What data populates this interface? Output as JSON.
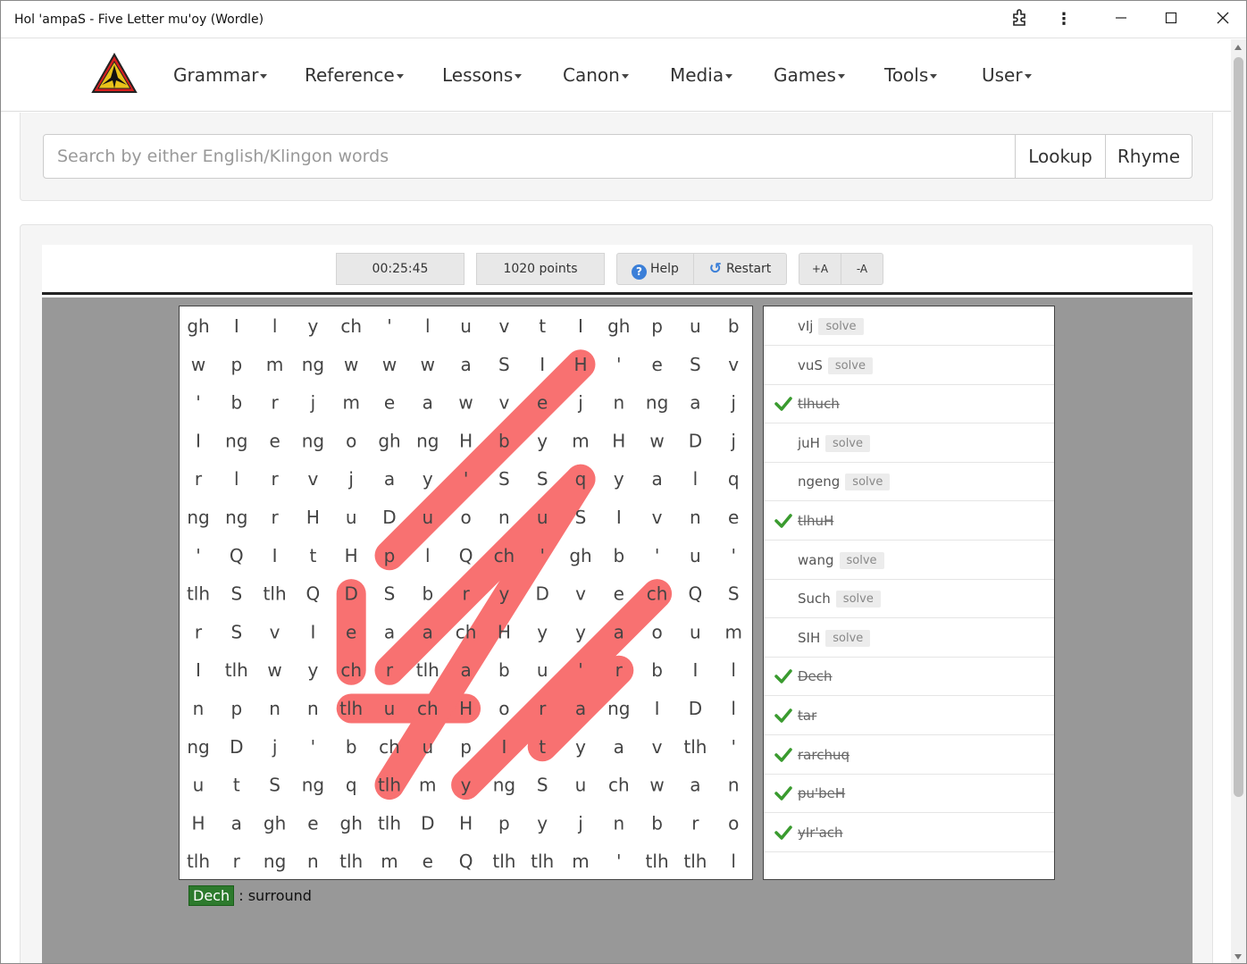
{
  "window": {
    "title": "Hol 'ampaS - Five Letter mu'oy (Wordle)"
  },
  "nav": {
    "logo": "klingon-trefoil-logo",
    "items": [
      "Grammar",
      "Reference",
      "Lessons",
      "Canon",
      "Media",
      "Games",
      "Tools",
      "User"
    ]
  },
  "search": {
    "placeholder": "Search by either English/Klingon words",
    "lookup_label": "Lookup",
    "rhyme_label": "Rhyme"
  },
  "toolbar": {
    "timer": "00:25:45",
    "points": "1020 points",
    "help_label": "Help",
    "restart_label": "Restart",
    "font_up_label": "+A",
    "font_down_label": "-A"
  },
  "grid": [
    [
      "gh",
      "I",
      "l",
      "y",
      "ch",
      "'",
      "l",
      "u",
      "v",
      "t",
      "I",
      "gh",
      "p",
      "u",
      "b"
    ],
    [
      "w",
      "p",
      "m",
      "ng",
      "w",
      "w",
      "w",
      "a",
      "S",
      "I",
      "H",
      "'",
      "e",
      "S",
      "v"
    ],
    [
      "'",
      "b",
      "r",
      "j",
      "m",
      "e",
      "a",
      "w",
      "v",
      "e",
      "j",
      "n",
      "ng",
      "a",
      "j"
    ],
    [
      "I",
      "ng",
      "e",
      "ng",
      "o",
      "gh",
      "ng",
      "H",
      "b",
      "y",
      "m",
      "H",
      "w",
      "D",
      "j"
    ],
    [
      "r",
      "l",
      "r",
      "v",
      "j",
      "a",
      "y",
      "'",
      "S",
      "S",
      "q",
      "y",
      "a",
      "l",
      "q"
    ],
    [
      "ng",
      "ng",
      "r",
      "H",
      "u",
      "D",
      "u",
      "o",
      "n",
      "u",
      "S",
      "I",
      "v",
      "n",
      "e"
    ],
    [
      "'",
      "Q",
      "I",
      "t",
      "H",
      "p",
      "l",
      "Q",
      "ch",
      "'",
      "gh",
      "b",
      "'",
      "u",
      "'"
    ],
    [
      "tlh",
      "S",
      "tlh",
      "Q",
      "D",
      "S",
      "b",
      "r",
      "y",
      "D",
      "v",
      "e",
      "ch",
      "Q",
      "S"
    ],
    [
      "r",
      "S",
      "v",
      "I",
      "e",
      "a",
      "a",
      "ch",
      "H",
      "y",
      "y",
      "a",
      "o",
      "u",
      "m"
    ],
    [
      "I",
      "tlh",
      "w",
      "y",
      "ch",
      "r",
      "tlh",
      "a",
      "b",
      "u",
      "'",
      "r",
      "b",
      "I",
      "l"
    ],
    [
      "n",
      "p",
      "n",
      "n",
      "tlh",
      "u",
      "ch",
      "H",
      "o",
      "r",
      "a",
      "ng",
      "I",
      "D",
      "l"
    ],
    [
      "ng",
      "D",
      "j",
      "'",
      "b",
      "ch",
      "u",
      "p",
      "I",
      "t",
      "y",
      "a",
      "v",
      "tlh",
      "'"
    ],
    [
      "u",
      "t",
      "S",
      "ng",
      "q",
      "tlh",
      "m",
      "y",
      "ng",
      "S",
      "u",
      "ch",
      "w",
      "a",
      "n"
    ],
    [
      "H",
      "a",
      "gh",
      "e",
      "gh",
      "tlh",
      "D",
      "H",
      "p",
      "y",
      "j",
      "n",
      "b",
      "r",
      "o"
    ],
    [
      "tlh",
      "r",
      "ng",
      "n",
      "tlh",
      "m",
      "e",
      "Q",
      "tlh",
      "tlh",
      "m",
      "'",
      "tlh",
      "tlh",
      "l"
    ]
  ],
  "found_words": [
    {
      "word": "tlhuch",
      "from": [
        10,
        4
      ],
      "to": [
        10,
        7
      ]
    },
    {
      "word": "tlhuH",
      "from": [
        12,
        5
      ],
      "to": [
        4,
        10
      ]
    },
    {
      "word": "Dech",
      "from": [
        7,
        4
      ],
      "to": [
        9,
        4
      ]
    },
    {
      "word": "tar",
      "from": [
        11,
        9
      ],
      "to": [
        9,
        11
      ]
    },
    {
      "word": "rarchuq",
      "from": [
        9,
        5
      ],
      "to": [
        4,
        10
      ]
    },
    {
      "word": "pu'beH",
      "from": [
        6,
        5
      ],
      "to": [
        1,
        10
      ]
    },
    {
      "word": "yIr'ach",
      "from": [
        12,
        7
      ],
      "to": [
        7,
        12
      ]
    }
  ],
  "word_list": [
    {
      "word": "vIj",
      "found": false
    },
    {
      "word": "vuS",
      "found": false
    },
    {
      "word": "tlhuch",
      "found": true
    },
    {
      "word": "juH",
      "found": false
    },
    {
      "word": "ngeng",
      "found": false
    },
    {
      "word": "tlhuH",
      "found": true
    },
    {
      "word": "wang",
      "found": false
    },
    {
      "word": "Such",
      "found": false
    },
    {
      "word": "SIH",
      "found": false
    },
    {
      "word": "Dech",
      "found": true
    },
    {
      "word": "tar",
      "found": true
    },
    {
      "word": "rarchuq",
      "found": true
    },
    {
      "word": "pu'beH",
      "found": true
    },
    {
      "word": "yIr'ach",
      "found": true
    }
  ],
  "solve_label": "solve",
  "definition": {
    "word": "Dech",
    "separator": ":",
    "meaning": "surround"
  },
  "colors": {
    "highlight": "#f87171",
    "found_check": "#3a9b2f",
    "definition_badge": "#2d7a2d",
    "game_background": "#989898"
  }
}
